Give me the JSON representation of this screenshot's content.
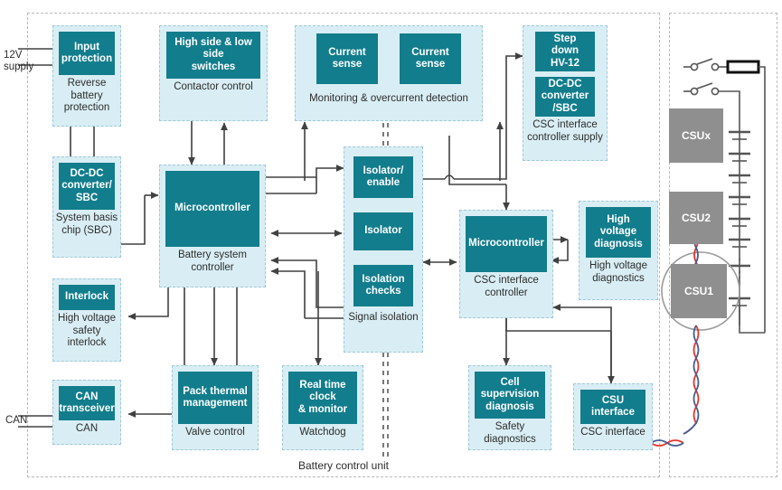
{
  "diagram": {
    "title": "Battery control unit block diagram",
    "colors": {
      "tile_teal": "#127d8c",
      "group_fill": "#d9eef4",
      "group_border": "#9fc8d6",
      "enclosure_border": "#b9b9b9",
      "csu_grey": "#8f8f8f",
      "wire": "#404040",
      "wire_red": "#e8322b",
      "wire_blue": "#3f5f92",
      "text_dark": "#2c2c2c",
      "text_light": "#ffffff"
    },
    "zone_labels": {
      "battery_control_unit": "Battery control unit"
    },
    "edge_labels": {
      "supply_12v": "12V\nsupply",
      "can": "CAN"
    },
    "groups": [
      {
        "id": "input-protection",
        "caption": "Reverse\nbattery\nprotection",
        "tiles": [
          {
            "label": "Input\nprotection"
          }
        ]
      },
      {
        "id": "dcdc-sbc",
        "caption": "System\nbasis chip\n(SBC)",
        "tiles": [
          {
            "label": "DC-DC\nconverter/\nSBC"
          }
        ]
      },
      {
        "id": "interlock",
        "caption": "High voltage\nsafety\ninterlock",
        "tiles": [
          {
            "label": "Interlock"
          }
        ]
      },
      {
        "id": "can",
        "caption": "CAN",
        "tiles": [
          {
            "label": "CAN\ntransceiver"
          }
        ]
      },
      {
        "id": "contactor-control",
        "caption": "Contactor control",
        "tiles": [
          {
            "label": "High side & low\nside\nswitches"
          }
        ]
      },
      {
        "id": "battery-system-controller",
        "caption": "Battery system\ncontroller",
        "tiles": [
          {
            "label": "Microcontroller"
          }
        ]
      },
      {
        "id": "valve-control",
        "caption": "Valve control",
        "tiles": [
          {
            "label": "Pack thermal\nmanagement"
          }
        ]
      },
      {
        "id": "watchdog",
        "caption": "Watchdog",
        "tiles": [
          {
            "label": "Real time\nclock\n& monitor"
          }
        ]
      },
      {
        "id": "monitoring-overcurrent",
        "caption": "Monitoring & overcurrent detection",
        "tiles": [
          {
            "label": "Current\nsense"
          },
          {
            "label": "Current\nsense"
          }
        ]
      },
      {
        "id": "signal-isolation",
        "caption": "Signal isolation",
        "tiles": [
          {
            "label": "Isolator/\nenable"
          },
          {
            "label": "Isolator"
          },
          {
            "label": "Isolation\nchecks"
          }
        ]
      },
      {
        "id": "csc-interface-controller-supply",
        "caption": "CSC interface\ncontroller\nsupply",
        "tiles": [
          {
            "label": "Step\ndown\nHV-12"
          },
          {
            "label": "DC-DC\nconverter\n/SBC"
          }
        ]
      },
      {
        "id": "csc-interface-controller",
        "caption": "CSC interface\ncontroller",
        "tiles": [
          {
            "label": "Microcontroller"
          }
        ]
      },
      {
        "id": "high-voltage-diagnostics",
        "caption": "High voltage\ndiagnostics",
        "tiles": [
          {
            "label": "High\nvoltage\ndiagnosis"
          }
        ]
      },
      {
        "id": "safety-diagnostics",
        "caption": "Safety\ndiagnostics",
        "tiles": [
          {
            "label": "Cell\nsupervision\ndiagnosis"
          }
        ]
      },
      {
        "id": "csc-interface",
        "caption": "CSC interface",
        "tiles": [
          {
            "label": "CSU\ninterface"
          }
        ]
      }
    ],
    "battery_pack": {
      "modules": [
        {
          "label": "CSUx"
        },
        {
          "label": "CSU2"
        },
        {
          "label": "CSU1"
        }
      ],
      "components": {
        "switch_count": 2,
        "resistor": "shunt",
        "cell_stack": "series cells"
      }
    }
  }
}
